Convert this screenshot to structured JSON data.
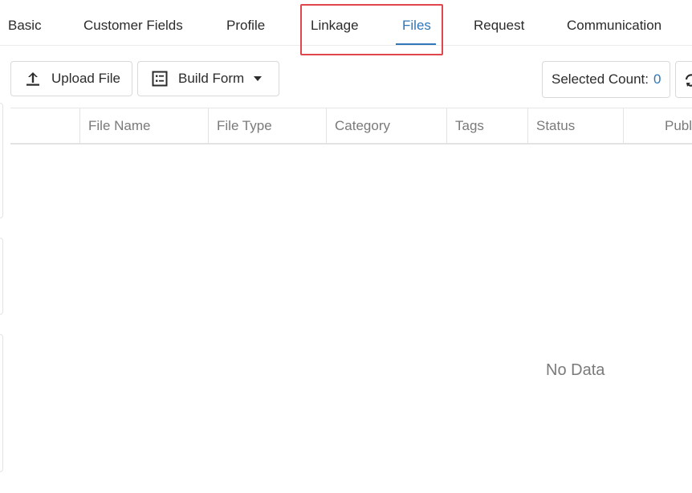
{
  "tabs": [
    {
      "label": "Basic",
      "active": false
    },
    {
      "label": "Customer Fields",
      "active": false
    },
    {
      "label": "Profile",
      "active": false
    },
    {
      "label": "Linkage",
      "active": false
    },
    {
      "label": "Files",
      "active": true
    },
    {
      "label": "Request",
      "active": false
    },
    {
      "label": "Communication",
      "active": false
    }
  ],
  "toolbar": {
    "upload_label": "Upload File",
    "upload_icon": "upload-icon",
    "build_label": "Build Form",
    "build_icon": "form-icon",
    "selected_count_label": "Selected Count:",
    "selected_count_value": "0",
    "refresh_icon": "refresh-icon"
  },
  "table": {
    "columns": [
      "File Name",
      "File Type",
      "Category",
      "Tags",
      "Status",
      "Publ"
    ],
    "empty_text": "No Data"
  },
  "colors": {
    "accent": "#2f77b8",
    "highlight": "#e0474c"
  }
}
